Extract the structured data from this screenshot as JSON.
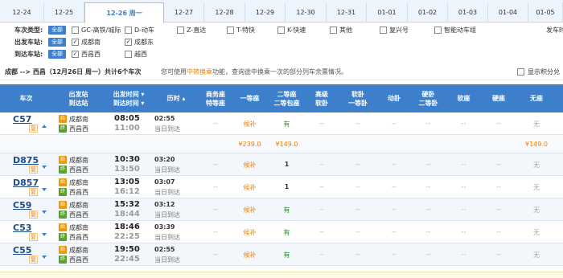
{
  "dates": [
    "12-24",
    "12-25",
    "12-26 周一",
    "12-27",
    "12-28",
    "12-29",
    "12-30",
    "12-31",
    "01-01",
    "01-02",
    "01-03",
    "01-04",
    "01-05"
  ],
  "active_date_index": 2,
  "filters": {
    "type_label": "车次类型:",
    "from_label": "出发车站:",
    "to_label": "到达车站:",
    "all": "全部",
    "types": [
      {
        "label": "GC-高铁/城际",
        "checked": false
      },
      {
        "label": "D-动车",
        "checked": false
      },
      {
        "label": "Z-直达",
        "checked": false
      },
      {
        "label": "T-特快",
        "checked": false
      },
      {
        "label": "K-快速",
        "checked": false
      },
      {
        "label": "其他",
        "checked": false
      },
      {
        "label": "复兴号",
        "checked": false
      },
      {
        "label": "智能动车组",
        "checked": false
      }
    ],
    "depart_time_label": "发车时",
    "from_stations": [
      {
        "label": "成都南",
        "checked": true
      },
      {
        "label": "成都东",
        "checked": true
      }
    ],
    "to_stations": [
      {
        "label": "西昌西",
        "checked": true
      },
      {
        "label": "越西",
        "checked": false
      }
    ]
  },
  "summary": {
    "route": "成都 --> 西昌（12月26日 周一）共计",
    "count": "6",
    "count_suffix": "个车次",
    "hint_prefix": "您可使用",
    "hint_link": "中转换乘",
    "hint_suffix": "功能，查询途中换乘一次的部分列车余票情况。",
    "show_points": "显示积分兑"
  },
  "headers": [
    "车次",
    "出发站\n到达站",
    "出发时间 ▾\n到达时间 ▾",
    "历时 ▴",
    "商务座\n特等座",
    "一等座",
    "二等座\n二等包座",
    "高级\n软卧",
    "软卧\n一等卧",
    "动卧",
    "硬卧\n二等卧",
    "软座",
    "硬座",
    "无座"
  ],
  "trains": [
    {
      "no": "C57",
      "fu": "复",
      "arrow": "up",
      "from": "成都南",
      "to": "西昌西",
      "dep": "08:05",
      "arr": "11:00",
      "dur": "02:55",
      "day": "当日到达",
      "seats": [
        "--",
        "候补",
        "有",
        "--",
        "--",
        "--",
        "--",
        "--",
        "--",
        "无"
      ]
    },
    {
      "no": "D875",
      "fu": "复",
      "arrow": "down",
      "from": "成都南",
      "to": "西昌西",
      "dep": "10:30",
      "arr": "13:50",
      "dur": "03:20",
      "day": "当日到达",
      "seats": [
        "--",
        "候补",
        "1",
        "--",
        "--",
        "--",
        "--",
        "--",
        "--",
        "无"
      ]
    },
    {
      "no": "D857",
      "fu": "复",
      "arrow": "down",
      "from": "成都南",
      "to": "西昌西",
      "dep": "13:05",
      "arr": "16:12",
      "dur": "03:07",
      "day": "当日到达",
      "seats": [
        "--",
        "候补",
        "1",
        "--",
        "--",
        "--",
        "--",
        "--",
        "--",
        "无"
      ]
    },
    {
      "no": "C59",
      "fu": "复",
      "arrow": "down",
      "from": "成都南",
      "to": "西昌西",
      "dep": "15:32",
      "arr": "18:44",
      "dur": "03:12",
      "day": "当日到达",
      "seats": [
        "--",
        "候补",
        "有",
        "--",
        "--",
        "--",
        "--",
        "--",
        "--",
        "无"
      ]
    },
    {
      "no": "C53",
      "fu": "复",
      "arrow": "down",
      "from": "成都南",
      "to": "西昌西",
      "dep": "18:46",
      "arr": "22:25",
      "dur": "03:39",
      "day": "当日到达",
      "seats": [
        "--",
        "候补",
        "有",
        "--",
        "--",
        "--",
        "--",
        "--",
        "--",
        "无"
      ]
    },
    {
      "no": "C55",
      "fu": "复",
      "arrow": "down",
      "from": "成都南",
      "to": "西昌西",
      "dep": "19:50",
      "arr": "22:45",
      "dur": "02:55",
      "day": "当日到达",
      "seats": [
        "--",
        "候补",
        "有",
        "--",
        "--",
        "--",
        "--",
        "--",
        "--",
        "无"
      ]
    }
  ],
  "price_row": {
    "first": "¥239.0",
    "second": "¥149.0",
    "none": "¥149.0"
  },
  "colors": {
    "accent": "#3e7fcb",
    "orange": "#f08200",
    "green": "#2c8a2c",
    "station_from": "#f39800",
    "station_to": "#5aa02c"
  }
}
